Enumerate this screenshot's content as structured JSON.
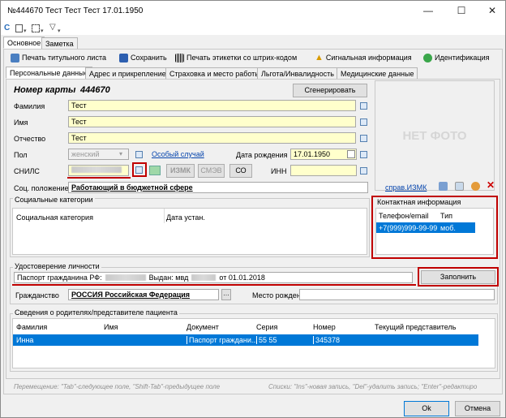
{
  "window": {
    "title": "№444670 Тест Тест Тест 17.01.1950",
    "minimize": "—",
    "maximize": "☐",
    "close": "✕"
  },
  "quick_toolbar": {
    "refresh": "C",
    "icons": [
      "page-icon",
      "steps-icon",
      "filter-icon"
    ]
  },
  "top_tabs": [
    {
      "label": "Основное"
    },
    {
      "label": "Заметка"
    }
  ],
  "toolbar": {
    "print_title": "Печать титульного листа",
    "save": "Сохранить",
    "print_barcode": "Печать этикетки со штрих-кодом",
    "signal_info": "Сигнальная информация",
    "identification": "Идентификация"
  },
  "sub_tabs": [
    {
      "label": "Персональные данные"
    },
    {
      "label": "Адрес и прикрепление"
    },
    {
      "label": "Страховка и место работы"
    },
    {
      "label": "Льгота/Инвалидность"
    },
    {
      "label": "Медицинские данные"
    }
  ],
  "card": {
    "label": "Номер карты",
    "number": "444670",
    "generate": "Сгенерировать"
  },
  "fields": {
    "surname_label": "Фамилия",
    "surname": "Тест",
    "name_label": "Имя",
    "name": "Тест",
    "patronymic_label": "Отчество",
    "patronymic": "Тест",
    "sex_label": "Пол",
    "sex": "женский",
    "special_case": "Особый случай",
    "birth_label": "Дата рождения",
    "birth": "17.01.1950",
    "snils_label": "СНИЛС",
    "izmk": "ИЗМК",
    "smev": "СМЭВ",
    "co": "СО",
    "inn_label": "ИНН",
    "social_label": "Соц. положение",
    "social": "Работающий в бюджетной сфере",
    "ref_izmk": "справ.ИЗМК"
  },
  "photo": {
    "text": "НЕТ ФОТО"
  },
  "social_categories": {
    "title": "Социальные категории",
    "columns": [
      "Социальная категория",
      "Дата устан."
    ]
  },
  "contact": {
    "title": "Контактная информация",
    "columns": [
      "Телефон/email",
      "Тип"
    ],
    "rows": [
      [
        "+7(999)999-99-99",
        "моб."
      ]
    ]
  },
  "identity": {
    "title": "Удостоверение личности",
    "text_a": "Паспорт гражданина РФ:",
    "text_b": "Выдан: мвд",
    "text_c": "от 01.01.2018",
    "fill": "Заполнить"
  },
  "citizenship": {
    "label": "Гражданство",
    "value": "РОССИЯ Российская Федерация",
    "birthplace_label": "Место рождения"
  },
  "parents": {
    "title": "Сведения о родителях/представителе пациента",
    "columns": [
      "Фамилия",
      "Имя",
      "Документ",
      "Серия",
      "Номер",
      "Текущий представитель"
    ],
    "rows": [
      [
        "Инна",
        "",
        "Паспорт граждани...",
        "55 55",
        "345378",
        ""
      ]
    ]
  },
  "hints": {
    "left": "Перемещение: \"Tab\"-следующее поле, \"Shift-Tab\"-предыдущее поле",
    "right": "Списки: \"Ins\"-новая запись, \"Del\"-удалить запись; \"Enter\"-редактиро"
  },
  "footer": {
    "ok": "Ok",
    "cancel": "Отмена"
  },
  "colors": {
    "accent": "#0078d7",
    "highlight": "#c00000",
    "field_yellow": "#ffffcc"
  }
}
